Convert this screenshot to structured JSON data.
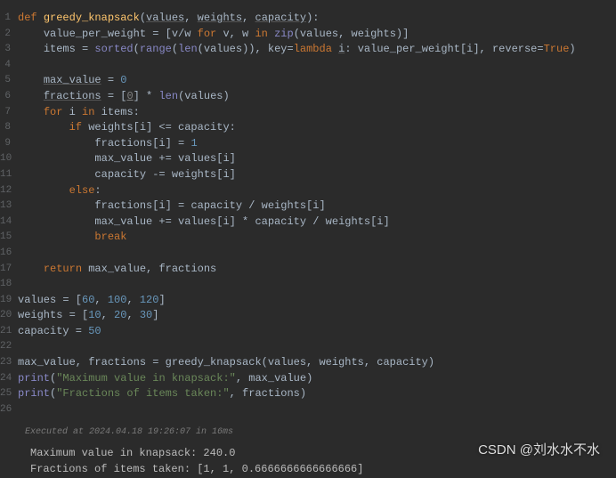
{
  "lines": [
    {
      "n": 1,
      "tokens": [
        {
          "c": "kw",
          "t": "def "
        },
        {
          "c": "fn",
          "t": "greedy_knapsack"
        },
        {
          "t": "("
        },
        {
          "c": "under",
          "t": "values"
        },
        {
          "t": ", "
        },
        {
          "c": "under",
          "t": "weights"
        },
        {
          "t": ", "
        },
        {
          "c": "under",
          "t": "capacity"
        },
        {
          "t": "):"
        }
      ],
      "indent": 0
    },
    {
      "n": 2,
      "tokens": [
        {
          "t": "value_per_weight = [v/w "
        },
        {
          "c": "kw",
          "t": "for"
        },
        {
          "t": " v, w "
        },
        {
          "c": "kw",
          "t": "in "
        },
        {
          "c": "builtin",
          "t": "zip"
        },
        {
          "t": "(values, weights)]"
        }
      ],
      "indent": 1
    },
    {
      "n": 3,
      "tokens": [
        {
          "t": "items = "
        },
        {
          "c": "builtin",
          "t": "sorted"
        },
        {
          "t": "("
        },
        {
          "c": "builtin",
          "t": "range"
        },
        {
          "t": "("
        },
        {
          "c": "builtin",
          "t": "len"
        },
        {
          "t": "(values)), "
        },
        {
          "c": "param",
          "t": "key"
        },
        {
          "t": "="
        },
        {
          "c": "kw",
          "t": "lambda "
        },
        {
          "c": "under",
          "t": "i"
        },
        {
          "t": ": value_per_weight[i], "
        },
        {
          "c": "param",
          "t": "reverse"
        },
        {
          "t": "="
        },
        {
          "c": "kw",
          "t": "True"
        },
        {
          "t": ")"
        }
      ],
      "indent": 1
    },
    {
      "n": 4,
      "tokens": [],
      "indent": 0
    },
    {
      "n": 5,
      "tokens": [
        {
          "c": "under",
          "t": "max_value"
        },
        {
          "t": " = "
        },
        {
          "c": "num",
          "t": "0"
        }
      ],
      "indent": 1
    },
    {
      "n": 6,
      "tokens": [
        {
          "c": "under",
          "t": "fractions"
        },
        {
          "t": " = ["
        },
        {
          "c": "wunder",
          "t": "0"
        },
        {
          "t": "] * "
        },
        {
          "c": "builtin",
          "t": "len"
        },
        {
          "t": "(values)"
        }
      ],
      "indent": 1
    },
    {
      "n": 7,
      "tokens": [
        {
          "c": "kw",
          "t": "for"
        },
        {
          "t": " i "
        },
        {
          "c": "kw",
          "t": "in"
        },
        {
          "t": " items:"
        }
      ],
      "indent": 1
    },
    {
      "n": 8,
      "tokens": [
        {
          "c": "kw",
          "t": "if"
        },
        {
          "t": " weights[i] <= capacity:"
        }
      ],
      "indent": 2
    },
    {
      "n": 9,
      "tokens": [
        {
          "t": "fractions[i] = "
        },
        {
          "c": "num",
          "t": "1"
        }
      ],
      "indent": 3
    },
    {
      "n": 10,
      "tokens": [
        {
          "t": "max_value += values[i]"
        }
      ],
      "indent": 3
    },
    {
      "n": 11,
      "tokens": [
        {
          "t": "capacity -= weights[i]"
        }
      ],
      "indent": 3
    },
    {
      "n": 12,
      "tokens": [
        {
          "c": "kw",
          "t": "else"
        },
        {
          "t": ":"
        }
      ],
      "indent": 2
    },
    {
      "n": 13,
      "tokens": [
        {
          "t": "fractions[i] = capacity / weights[i]"
        }
      ],
      "indent": 3
    },
    {
      "n": 14,
      "tokens": [
        {
          "t": "max_value += values[i] * capacity / weights[i]"
        }
      ],
      "indent": 3
    },
    {
      "n": 15,
      "tokens": [
        {
          "c": "kw",
          "t": "break"
        }
      ],
      "indent": 3
    },
    {
      "n": 16,
      "tokens": [],
      "indent": 0
    },
    {
      "n": 17,
      "tokens": [
        {
          "c": "kw",
          "t": "return"
        },
        {
          "t": " max_value, fractions"
        }
      ],
      "indent": 1
    },
    {
      "n": 18,
      "tokens": [],
      "indent": 0
    },
    {
      "n": 19,
      "tokens": [
        {
          "t": "values = ["
        },
        {
          "c": "num",
          "t": "60"
        },
        {
          "t": ", "
        },
        {
          "c": "num",
          "t": "100"
        },
        {
          "t": ", "
        },
        {
          "c": "num",
          "t": "120"
        },
        {
          "t": "]"
        }
      ],
      "indent": 0
    },
    {
      "n": 20,
      "tokens": [
        {
          "t": "weights = ["
        },
        {
          "c": "num",
          "t": "10"
        },
        {
          "t": ", "
        },
        {
          "c": "num",
          "t": "20"
        },
        {
          "t": ", "
        },
        {
          "c": "num",
          "t": "30"
        },
        {
          "t": "]"
        }
      ],
      "indent": 0
    },
    {
      "n": 21,
      "tokens": [
        {
          "t": "capacity = "
        },
        {
          "c": "num",
          "t": "50"
        }
      ],
      "indent": 0
    },
    {
      "n": 22,
      "tokens": [],
      "indent": 0
    },
    {
      "n": 23,
      "tokens": [
        {
          "t": "max_value, fractions = greedy_knapsack(values, weights, capacity)"
        }
      ],
      "indent": 0
    },
    {
      "n": 24,
      "tokens": [
        {
          "c": "builtin",
          "t": "print"
        },
        {
          "t": "("
        },
        {
          "c": "str",
          "t": "\"Maximum value in knapsack:\""
        },
        {
          "t": ", max_value)"
        }
      ],
      "indent": 0
    },
    {
      "n": 25,
      "tokens": [
        {
          "c": "builtin",
          "t": "print"
        },
        {
          "t": "("
        },
        {
          "c": "str",
          "t": "\"Fractions of items taken:\""
        },
        {
          "t": ", fractions)"
        }
      ],
      "indent": 0
    },
    {
      "n": 26,
      "tokens": [],
      "indent": 0
    }
  ],
  "exec_status": "Executed at 2024.04.18 19:26:07 in 16ms",
  "output": [
    "Maximum value in knapsack: 240.0",
    "Fractions of items taken: [1, 1, 0.6666666666666666]"
  ],
  "watermark": "CSDN @刘水水不水"
}
